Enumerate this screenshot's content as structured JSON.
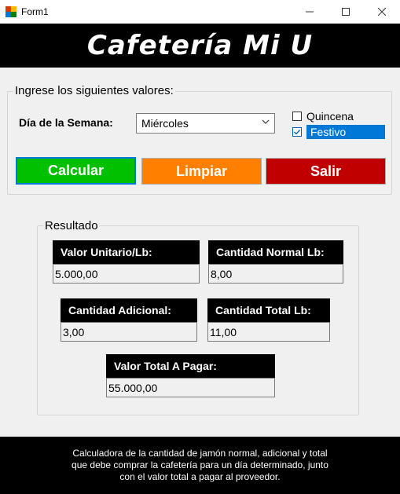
{
  "window": {
    "title": "Form1",
    "minimize": "—",
    "maximize": "☐",
    "close": "✕"
  },
  "header": {
    "title": "Cafetería Mi U"
  },
  "inputs": {
    "group_title": "Ingrese los siguientes valores:",
    "day_label": "Día de la Semana:",
    "day_value": "Miércoles",
    "quincena_label": "Quincena",
    "quincena_checked": false,
    "festivo_label": "Festivo",
    "festivo_checked": true
  },
  "buttons": {
    "calcular": "Calcular",
    "limpiar": "Limpiar",
    "salir": "Salir"
  },
  "results": {
    "group_title": "Resultado",
    "valor_unitario_label": "Valor Unitario/Lb:",
    "valor_unitario_value": "5.000,00",
    "cantidad_normal_label": "Cantidad Normal Lb:",
    "cantidad_normal_value": "8,00",
    "cantidad_adicional_label": "Cantidad Adicional:",
    "cantidad_adicional_value": "3,00",
    "cantidad_total_label": "Cantidad Total Lb:",
    "cantidad_total_value": "11,00",
    "valor_total_label": "Valor Total A Pagar:",
    "valor_total_value": "55.000,00"
  },
  "footer": {
    "line1": "Calculadora de la cantidad de jamón normal, adicional y total",
    "line2": "que debe comprar la cafetería para un día determinado, junto",
    "line3": "con el valor total a pagar al proveedor."
  }
}
